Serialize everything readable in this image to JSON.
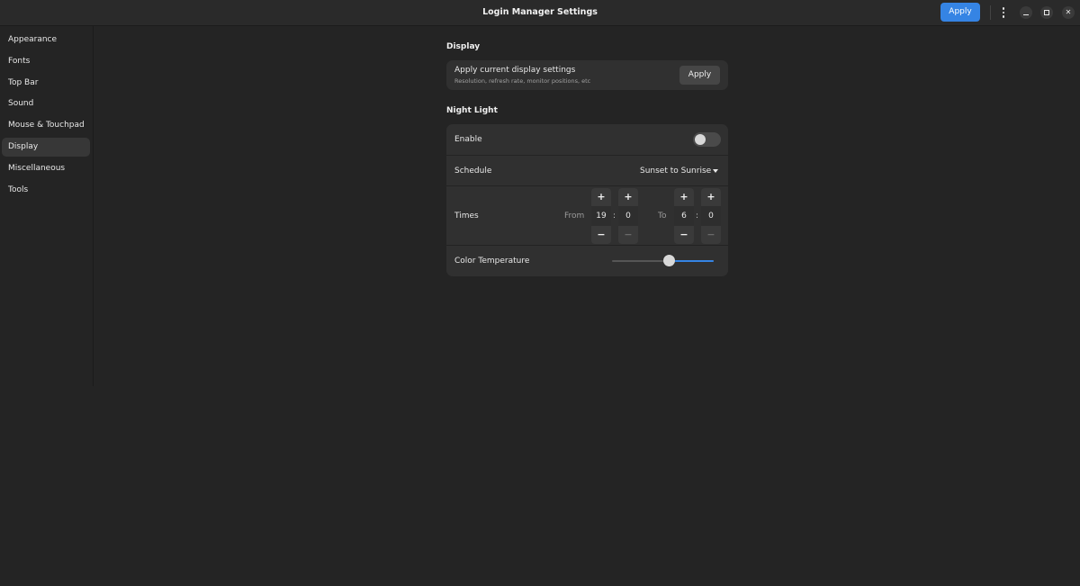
{
  "header": {
    "title": "Login Manager Settings",
    "apply_label": "Apply",
    "icons": [
      "view-more-icon",
      "minimize-icon",
      "maximize-icon",
      "close-icon"
    ]
  },
  "sidebar": {
    "items": [
      {
        "label": "Appearance"
      },
      {
        "label": "Fonts"
      },
      {
        "label": "Top Bar"
      },
      {
        "label": "Sound"
      },
      {
        "label": "Mouse & Touchpad"
      },
      {
        "label": "Display",
        "active": true
      },
      {
        "label": "Miscellaneous"
      },
      {
        "label": "Tools"
      }
    ]
  },
  "display": {
    "title": "Display",
    "apply_row_title": "Apply current display settings",
    "apply_row_subtitle": "Resolution, refresh rate, monitor positions, etc",
    "apply_button": "Apply"
  },
  "night_light": {
    "title": "Night Light",
    "enable_label": "Enable",
    "enable_state": false,
    "schedule_label": "Schedule",
    "schedule_value": "Sunset to Sunrise",
    "times_label": "Times",
    "from_label": "From",
    "to_label": "To",
    "from_hour": "19",
    "from_minute": "0",
    "to_hour": "6",
    "to_minute": "0",
    "colon": ":",
    "plus": "+",
    "minus": "−",
    "color_temperature_label": "Color Temperature",
    "color_temperature_level": 0.56
  },
  "colors": {
    "accent": "#3584e4",
    "background": "#242424",
    "card": "#303030"
  }
}
